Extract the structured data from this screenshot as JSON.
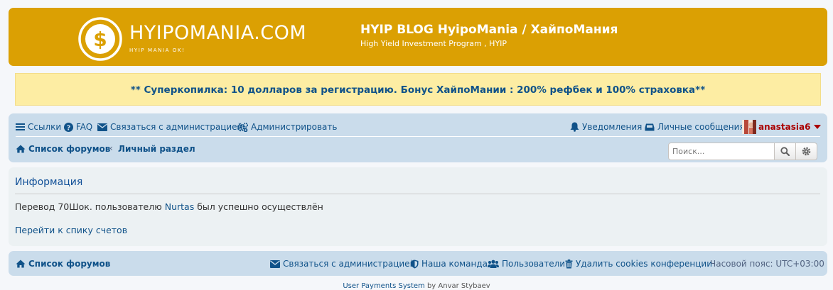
{
  "header": {
    "logo_text": "HYIPOMANIA.COM",
    "logo_sub": "HYIP MANIA OK!",
    "site_title": "HYIP BLOG HyipoMania / ХайпоМания",
    "site_desc": "High Yield Investment Program , HYIP",
    "bg_color": "#dba003"
  },
  "announcement": {
    "text": "** Суперкопилка: 10 долларов за регистрацию. Бонус ХайпоМании : 200% рефбек и 100% страховка**"
  },
  "navbar": {
    "links": "Ссылки",
    "faq": "FAQ",
    "contact": "Связаться с администрацией",
    "admin": "Администрировать",
    "notifications": "Уведомления",
    "messages": "Личные сообщения",
    "username": "anastasia6"
  },
  "breadcrumbs": {
    "forum_index": "Список форумов",
    "personal": "Личный раздел"
  },
  "search": {
    "placeholder": "Поиск..."
  },
  "panel": {
    "title": "Информация",
    "msg_before": "Перевод 70Шок. пользователю ",
    "msg_user": "Nurtas",
    "msg_after": " был успешно осуществлён",
    "back_link": "Перейти к спику счетов"
  },
  "footer": {
    "forum_index": "Список форумов",
    "contact": "Связаться с администрацией",
    "team": "Наша команда",
    "users": "Пользователи",
    "delete_cookies": "Удалить cookies конференции",
    "timezone": "Часовой пояс: UTC+03:00"
  },
  "copyright": {
    "link": "User Payments System",
    "by": " by Anvar Stybaev"
  },
  "colors": {
    "accent": "#105289",
    "navbar_bg": "#cadceb",
    "panel_bg": "#ecf1f3",
    "announce_bg": "#fdeda3",
    "username": "#aa0000"
  }
}
